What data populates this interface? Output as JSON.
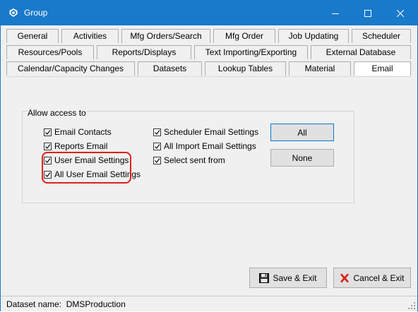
{
  "window": {
    "title": "Group",
    "title_color": "#1979ca",
    "icons": {
      "app": "app-logo-icon",
      "minimize": "minimize-icon",
      "maximize": "maximize-icon",
      "close": "close-icon"
    }
  },
  "tabs": {
    "row1": [
      "General",
      "Activities",
      "Mfg Orders/Search",
      "Mfg Order",
      "Job Updating",
      "Scheduler"
    ],
    "row2": [
      "Resources/Pools",
      "Reports/Displays",
      "Text Importing/Exporting",
      "External Database"
    ],
    "row3": [
      "Calendar/Capacity Changes",
      "Datasets",
      "Lookup Tables",
      "Material",
      "Email"
    ],
    "active": "Email"
  },
  "access_group": {
    "label": "Allow access to",
    "left_column": [
      {
        "label": "Email Contacts",
        "checked": true
      },
      {
        "label": "Reports Email",
        "checked": true
      },
      {
        "label": "User Email Settings",
        "checked": true
      },
      {
        "label": "All User Email Settings",
        "checked": true
      }
    ],
    "right_column": [
      {
        "label": "Scheduler Email Settings",
        "checked": true
      },
      {
        "label": "All Import Email Settings",
        "checked": true
      },
      {
        "label": "Select sent from",
        "checked": true
      }
    ],
    "buttons": {
      "all": "All",
      "none": "None"
    },
    "highlight_color": "#e0201a"
  },
  "footer": {
    "save_exit": "Save & Exit",
    "cancel_exit": "Cancel & Exit",
    "save_icon": "floppy-disk-icon",
    "cancel_icon": "red-x-icon"
  },
  "status": {
    "text": "Dataset name:  DMSProduction"
  }
}
